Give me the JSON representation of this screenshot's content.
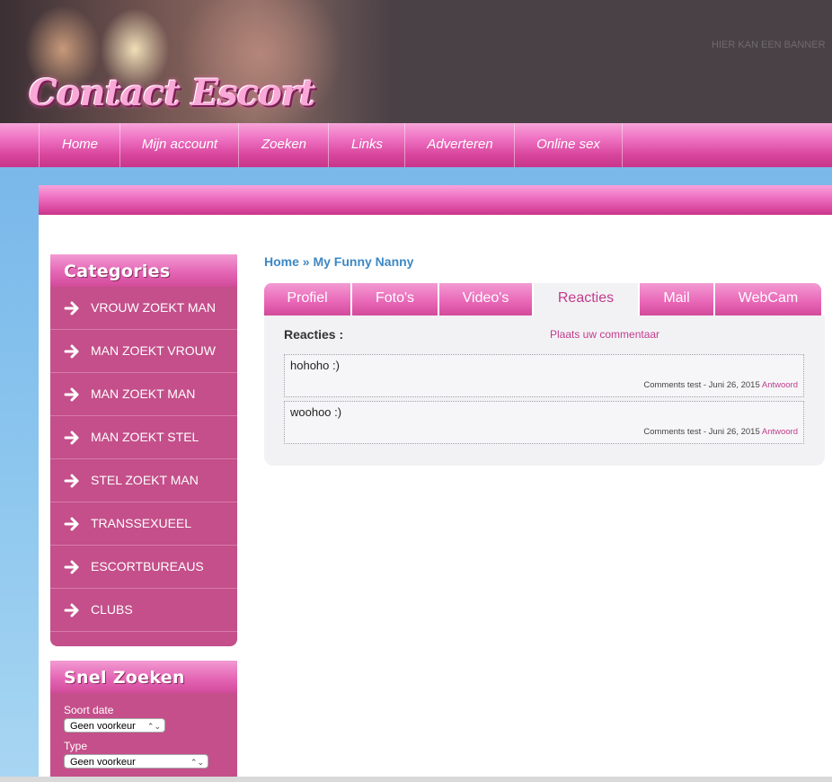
{
  "header": {
    "logo_text": "Contact Escort",
    "banner_text": "HIER KAN EEN BANNER"
  },
  "topnav": {
    "items": [
      "Home",
      "Mijn account",
      "Zoeken",
      "Links",
      "Adverteren",
      "Online sex"
    ]
  },
  "sidebar": {
    "categories_title": "Categories",
    "categories": [
      "VROUW ZOEKT MAN",
      "MAN ZOEKT VROUW",
      "MAN ZOEKT MAN",
      "MAN ZOEKT STEL",
      "STEL ZOEKT MAN",
      "TRANSSEXUEEL",
      "ESCORTBUREAUS",
      "CLUBS"
    ],
    "quick_search": {
      "title": "Snel Zoeken",
      "soort_label": "Soort date",
      "soort_value": "Geen voorkeur",
      "type_label": "Type",
      "type_value": "Geen voorkeur"
    }
  },
  "breadcrumb": "Home » My Funny Nanny",
  "tabs": {
    "items": [
      "Profiel",
      "Foto's",
      "Video's",
      "Reacties",
      "Mail",
      "WebCam"
    ],
    "active": "Reacties"
  },
  "reactions": {
    "title": "Reacties :",
    "post_link": "Plaats uw commentaar",
    "comments": [
      {
        "text": "hohoho :)",
        "meta": "Comments test - Juni 26, 2015",
        "reply": "Antwoord"
      },
      {
        "text": "woohoo :)",
        "meta": "Comments test - Juni 26, 2015",
        "reply": "Antwoord"
      }
    ]
  },
  "colors": {
    "accent_pink": "#c23c8c",
    "link_blue": "#3d88c4",
    "sidebar_pink": "#c44f8a"
  }
}
